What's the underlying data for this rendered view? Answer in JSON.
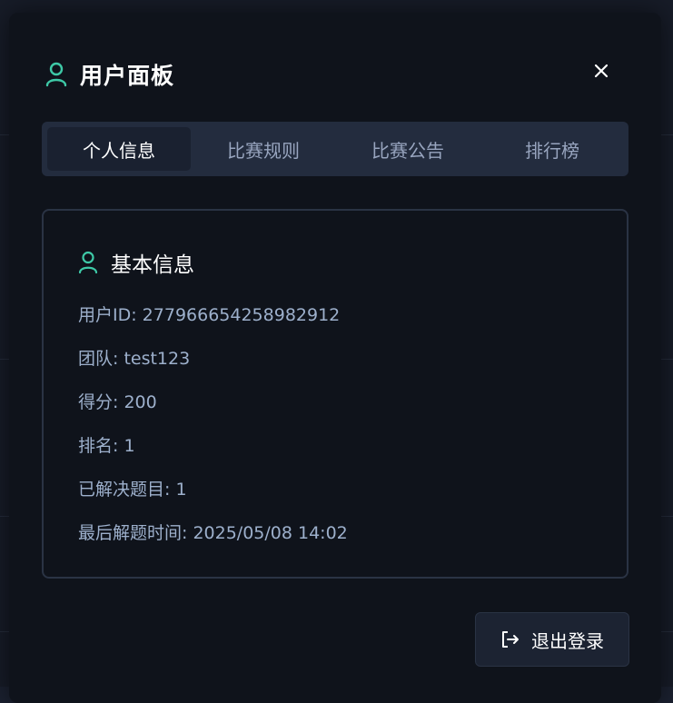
{
  "dialog": {
    "title": "用户面板",
    "accent_color": "#3ec9a7"
  },
  "tabs": [
    {
      "label": "个人信息",
      "active": true
    },
    {
      "label": "比赛规则",
      "active": false
    },
    {
      "label": "比赛公告",
      "active": false
    },
    {
      "label": "排行榜",
      "active": false
    }
  ],
  "basic_info": {
    "title": "基本信息",
    "rows": [
      "用户ID: 277966654258982912",
      "团队: test123",
      "得分: 200",
      "排名: 1",
      "已解决题目: 1",
      "最后解题时间: 2025/05/08 14:02"
    ]
  },
  "logout": {
    "label": "退出登录"
  },
  "icons": {
    "title": "user-icon",
    "close": "close-icon",
    "card": "user-icon",
    "logout": "logout-icon"
  }
}
